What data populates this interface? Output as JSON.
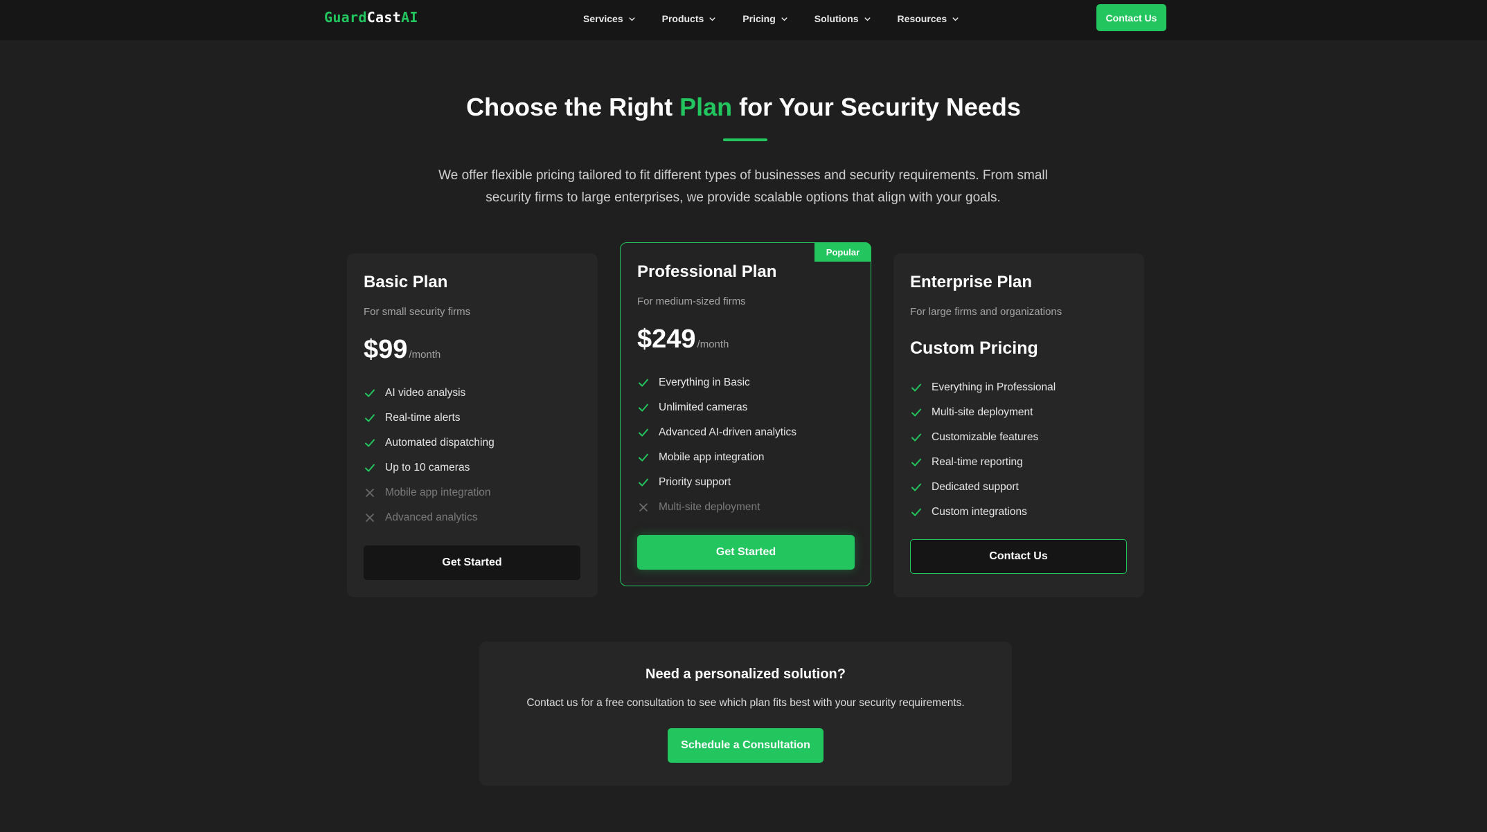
{
  "nav": {
    "logo": {
      "part1": "Guard",
      "part2": "Cast",
      "part3": "AI"
    },
    "items": [
      {
        "label": "Services"
      },
      {
        "label": "Products"
      },
      {
        "label": "Pricing"
      },
      {
        "label": "Solutions"
      },
      {
        "label": "Resources"
      }
    ],
    "contact_label": "Contact Us"
  },
  "hero": {
    "title_before": "Choose the Right ",
    "title_accent": "Plan",
    "title_after": " for Your Security Needs",
    "subtitle": "We offer flexible pricing tailored to fit different types of businesses and security requirements. From small security firms to large enterprises, we provide scalable options that align with your goals."
  },
  "plans": [
    {
      "name": "Basic Plan",
      "description": "For small security firms",
      "price": "$99",
      "period": "/month",
      "features": [
        {
          "text": "AI video analysis",
          "included": true
        },
        {
          "text": "Real-time alerts",
          "included": true
        },
        {
          "text": "Automated dispatching",
          "included": true
        },
        {
          "text": "Up to 10 cameras",
          "included": true
        },
        {
          "text": "Mobile app integration",
          "included": false
        },
        {
          "text": "Advanced analytics",
          "included": false
        }
      ],
      "button": "Get Started"
    },
    {
      "name": "Professional Plan",
      "badge": "Popular",
      "description": "For medium-sized firms",
      "price": "$249",
      "period": "/month",
      "features": [
        {
          "text": "Everything in Basic",
          "included": true
        },
        {
          "text": "Unlimited cameras",
          "included": true
        },
        {
          "text": "Advanced AI-driven analytics",
          "included": true
        },
        {
          "text": "Mobile app integration",
          "included": true
        },
        {
          "text": "Priority support",
          "included": true
        },
        {
          "text": "Multi-site deployment",
          "included": false
        }
      ],
      "button": "Get Started"
    },
    {
      "name": "Enterprise Plan",
      "description": "For large firms and organizations",
      "price": "Custom Pricing",
      "features": [
        {
          "text": "Everything in Professional",
          "included": true
        },
        {
          "text": "Multi-site deployment",
          "included": true
        },
        {
          "text": "Customizable features",
          "included": true
        },
        {
          "text": "Real-time reporting",
          "included": true
        },
        {
          "text": "Dedicated support",
          "included": true
        },
        {
          "text": "Custom integrations",
          "included": true
        }
      ],
      "button": "Contact Us"
    }
  ],
  "cta": {
    "title": "Need a personalized solution?",
    "text": "Contact us for a free consultation to see which plan fits best with your security requirements.",
    "button": "Schedule a Consultation"
  },
  "colors": {
    "accent": "#22c55e",
    "background": "#1f1f1f",
    "card": "#262626",
    "navbar": "#161616"
  },
  "icons": {
    "included": "check-icon",
    "excluded": "x-icon",
    "dropdown": "chevron-down-icon"
  }
}
